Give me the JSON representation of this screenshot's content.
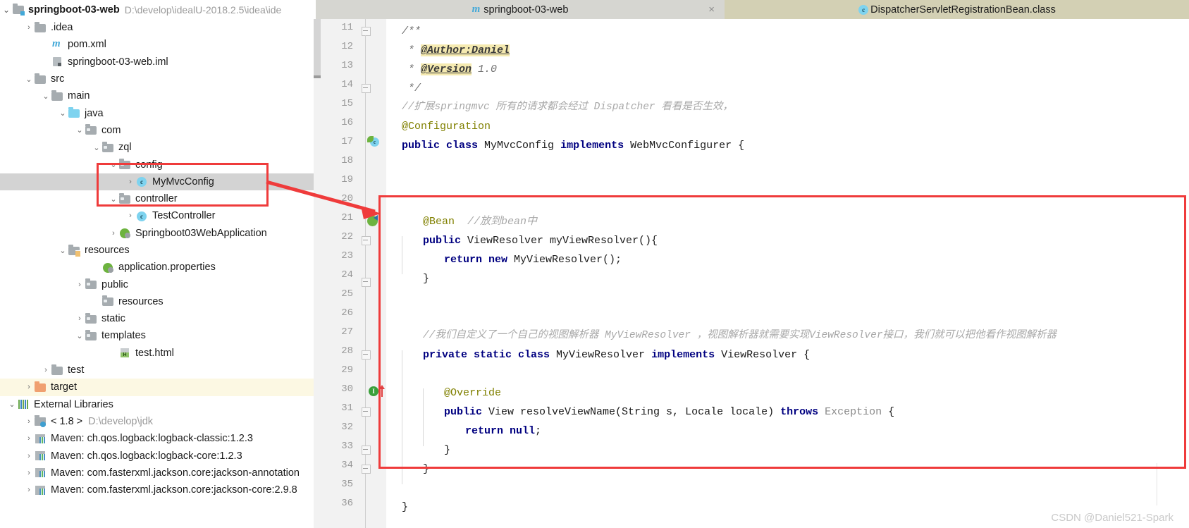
{
  "project": {
    "name": "springboot-03-web",
    "path": "D:\\develop\\idealU-2018.2.5\\idea\\ide",
    "twisty": "⌄"
  },
  "tabs": [
    {
      "label": "springboot-03-web",
      "icon": "maven-m-icon",
      "close": "×",
      "state": "active"
    },
    {
      "label": "DispatcherServletRegistrationBean.class",
      "icon": "class-icon",
      "state": "inactive"
    }
  ],
  "tree": [
    {
      "indent": 1,
      "arrow": "›",
      "icon": "folder-icon",
      "label": ".idea"
    },
    {
      "indent": 2,
      "arrow": "",
      "icon": "maven-m-icon",
      "label": "pom.xml"
    },
    {
      "indent": 2,
      "arrow": "",
      "icon": "iml-file-icon",
      "label": "springboot-03-web.iml"
    },
    {
      "indent": 1,
      "arrow": "⌄",
      "icon": "folder-icon",
      "label": "src"
    },
    {
      "indent": 2,
      "arrow": "⌄",
      "icon": "folder-icon",
      "label": "main"
    },
    {
      "indent": 3,
      "arrow": "⌄",
      "icon": "folder-source-icon",
      "label": "java"
    },
    {
      "indent": 4,
      "arrow": "⌄",
      "icon": "folder-package-icon",
      "label": "com"
    },
    {
      "indent": 5,
      "arrow": "⌄",
      "icon": "folder-package-icon",
      "label": "zql"
    },
    {
      "indent": 6,
      "arrow": "⌄",
      "icon": "folder-package-icon",
      "label": "config"
    },
    {
      "indent": 7,
      "arrow": "›",
      "icon": "class-icon",
      "label": "MyMvcConfig",
      "selected": true
    },
    {
      "indent": 6,
      "arrow": "⌄",
      "icon": "folder-package-icon",
      "label": "controller"
    },
    {
      "indent": 7,
      "arrow": "›",
      "icon": "class-icon",
      "label": "TestController"
    },
    {
      "indent": 6,
      "arrow": "›",
      "icon": "spring-class-icon",
      "label": "Springboot03WebApplication"
    },
    {
      "indent": 3,
      "arrow": "⌄",
      "icon": "folder-resources-icon",
      "label": "resources"
    },
    {
      "indent": 5,
      "arrow": "",
      "icon": "spring-properties-icon",
      "label": "application.properties"
    },
    {
      "indent": 4,
      "arrow": "›",
      "icon": "folder-package-icon",
      "label": "public"
    },
    {
      "indent": 5,
      "arrow": "",
      "icon": "folder-package-icon",
      "label": "resources"
    },
    {
      "indent": 4,
      "arrow": "›",
      "icon": "folder-package-icon",
      "label": "static"
    },
    {
      "indent": 4,
      "arrow": "⌄",
      "icon": "folder-package-icon",
      "label": "templates"
    },
    {
      "indent": 6,
      "arrow": "",
      "icon": "html-file-icon",
      "label": "test.html"
    },
    {
      "indent": 2,
      "arrow": "›",
      "icon": "folder-icon",
      "label": "test"
    },
    {
      "indent": 1,
      "arrow": "›",
      "icon": "folder-target-icon",
      "label": "target",
      "highlight": true
    },
    {
      "indent": 0,
      "arrow": "⌄",
      "icon": "external-libraries-icon",
      "label": "External Libraries"
    },
    {
      "indent": 1,
      "arrow": "›",
      "icon": "jdk-icon",
      "label": "< 1.8 >",
      "dim": "D:\\develop\\jdk"
    },
    {
      "indent": 1,
      "arrow": "›",
      "icon": "maven-lib-icon",
      "label": "Maven: ch.qos.logback:logback-classic:1.2.3"
    },
    {
      "indent": 1,
      "arrow": "›",
      "icon": "maven-lib-icon",
      "label": "Maven: ch.qos.logback:logback-core:1.2.3"
    },
    {
      "indent": 1,
      "arrow": "›",
      "icon": "maven-lib-icon",
      "label": "Maven: com.fasterxml.jackson.core:jackson-annotation"
    },
    {
      "indent": 1,
      "arrow": "›",
      "icon": "maven-lib-icon",
      "label": "Maven: com.fasterxml.jackson.core:jackson-core:2.9.8"
    }
  ],
  "editor": {
    "first_line": 11,
    "last_line": 36,
    "lines": {
      "11": "/**",
      "12_star": " * ",
      "12_tag": "@Author:Daniel",
      "13_star": " * ",
      "13_tag": "@Version",
      "13_rest": " 1.0",
      "14": " */",
      "15": "//扩展springmvc 所有的请求都会经过 Dispatcher 看看是否生效，",
      "16": "@Configuration",
      "17_kw1": "public class",
      "17_name": " MyMvcConfig ",
      "17_kw2": "implements",
      "17_rest": " WebMvcConfigurer {",
      "21_anno": "@Bean",
      "21_cmt": "  //放到bean中",
      "22_kw": "public",
      "22_rest": " ViewResolver myViewResolver(){",
      "23_kw": "return new",
      "23_rest": " MyViewResolver();",
      "24": "}",
      "27": "//我们自定义了一个自己的视图解析器 MyViewResolver ，视图解析器就需要实现ViewResolver接口，我们就可以把他看作视图解析器",
      "28_kw1": "private static class",
      "28_name": " MyViewResolver ",
      "28_kw2": "implements",
      "28_rest": " ViewResolver {",
      "30": "@Override",
      "31_kw1": "public",
      "31_mid": " View resolveViewName(String s, Locale locale) ",
      "31_kw2": "throws",
      "31_exc": " Exception",
      "31_rest": " {",
      "32_kw": "return null",
      "32_rest": ";",
      "33": "}",
      "34": "}",
      "36": "}"
    }
  },
  "annotations": {
    "watermark": "CSDN @Daniel521-Spark",
    "accent_red": "#ef3b3b"
  }
}
